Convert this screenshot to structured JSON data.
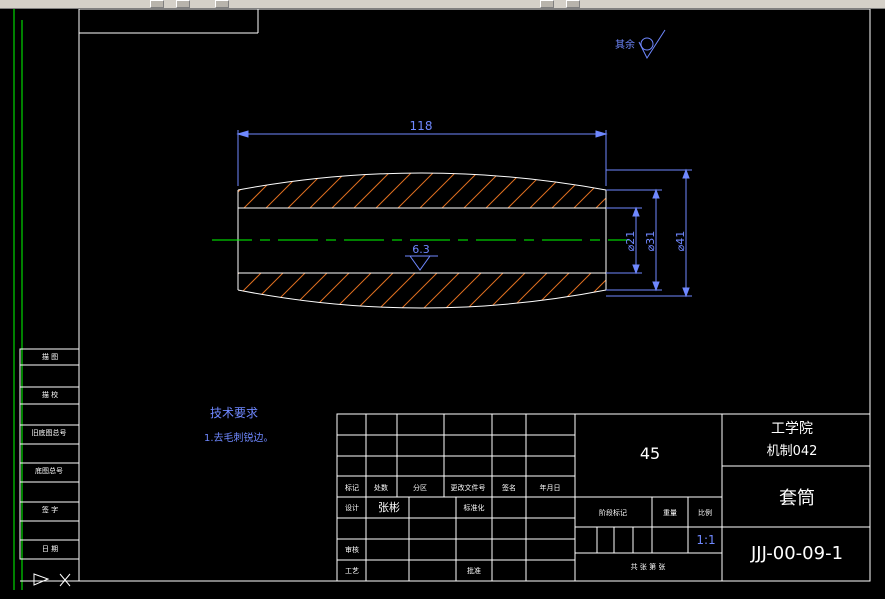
{
  "drawing": {
    "roughness_label": "其余",
    "dimensions": {
      "length": "118",
      "inner_diameter": "⌀21",
      "middle_diameter": "⌀31",
      "outer_diameter": "⌀41",
      "surface_roughness": "6.3"
    }
  },
  "tech_requirements": {
    "title": "技术要求",
    "items": [
      "1.去毛刺锐边。"
    ]
  },
  "side_panel": {
    "labels": [
      "描 图",
      "描 校",
      "旧底图总号",
      "底图总号",
      "签 字",
      "日 期"
    ]
  },
  "title_block": {
    "headers": [
      "标记",
      "处数",
      "分区",
      "更改文件号",
      "签名",
      "年月日"
    ],
    "designer_label": "设计",
    "designer_name": "张彬",
    "standardization_label": "标准化",
    "review_label": "审核",
    "process_label": "工艺",
    "approve_label": "批准",
    "material": "45",
    "stage_label": "阶段标记",
    "weight_label": "重量",
    "scale_label": "比例",
    "scale_value": "1:1",
    "sheets_label": "共 张 第 张",
    "school": "工学院",
    "class_name": "机制042",
    "part_name": "套筒",
    "drawing_number": "JJJ-00-09-1"
  },
  "colors": {
    "background": "#000000",
    "outline": "#ffffff",
    "dimension": "#6f88ff",
    "hatch": "#e07020",
    "centerline": "#00ff00",
    "frame": "#00ff00"
  }
}
